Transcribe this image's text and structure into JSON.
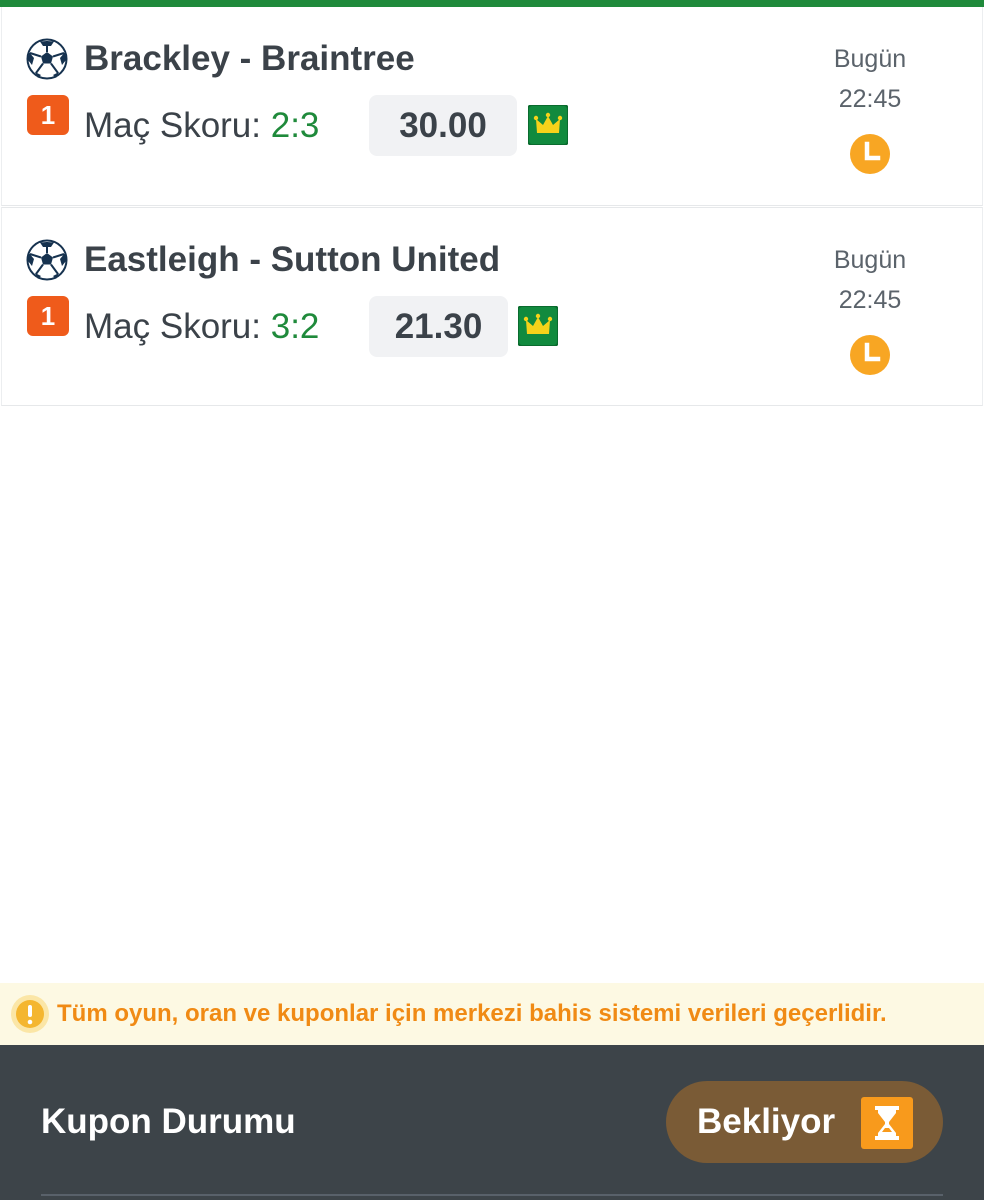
{
  "matches": [
    {
      "teams": "Brackley - Braintree",
      "bet_badge": "1",
      "bet_label": "Maç Skoru: ",
      "bet_value": "2:3",
      "odd": "30.00",
      "day": "Bugün",
      "time": "22:45"
    },
    {
      "teams": "Eastleigh - Sutton United",
      "bet_badge": "1",
      "bet_label": "Maç Skoru: ",
      "bet_value": "3:2",
      "odd": "21.30",
      "day": "Bugün",
      "time": "22:45"
    }
  ],
  "notice": {
    "text": "Tüm oyun, oran ve kuponlar için merkezi bahis sistemi verileri geçerlidir.",
    "icon": "warning-icon"
  },
  "footer": {
    "title": "Kupon Durumu",
    "status": "Bekliyor",
    "status_icon": "hourglass-icon"
  },
  "colors": {
    "brand_green": "#1f8a3b",
    "badge_orange": "#ef5b1b",
    "clock_orange": "#f8a623",
    "notice_text": "#f08a14",
    "footer_bg": "#3d4449",
    "status_pill": "#7a5b36"
  }
}
